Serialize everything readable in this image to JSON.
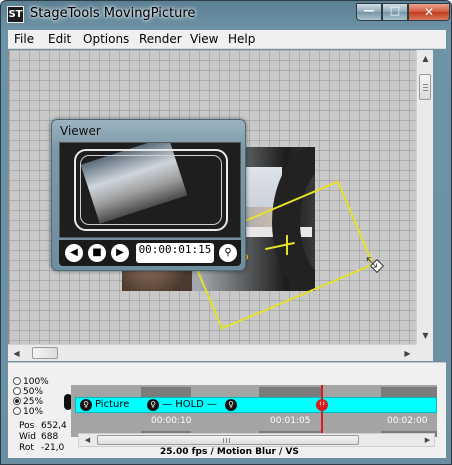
{
  "window": {
    "title": "StageTools MovingPicture",
    "app_icon": "ST",
    "controls": {
      "minimize": "—",
      "maximize": "□",
      "close": "✕"
    }
  },
  "menu": [
    "File",
    "Edit",
    "Options",
    "Render",
    "View",
    "Help"
  ],
  "viewer": {
    "title": "Viewer",
    "timecode": "00:00:01:15",
    "buttons": {
      "prev": "◀",
      "stop": "■",
      "next": "▶",
      "keyframe": "⚲"
    }
  },
  "zoom_options": [
    {
      "label": "100%",
      "selected": false
    },
    {
      "label": "50%",
      "selected": false
    },
    {
      "label": "25%",
      "selected": true
    },
    {
      "label": "10%",
      "selected": false
    }
  ],
  "info": {
    "pos_label": "Pos",
    "pos_value": "652,4",
    "wid_label": "Wid",
    "wid_value": "688",
    "rot_label": "Rot",
    "rot_value": "-21,0"
  },
  "timeline": {
    "track_name": "Picture",
    "hold_label": "HOLD",
    "ticks": [
      "00:00:10",
      "00:01:05",
      "00:02:00"
    ]
  },
  "status": "25.00 fps / Motion Blur / VS",
  "scroll_arrows": {
    "up": "▲",
    "down": "▼",
    "left": "◀",
    "right": "▶"
  },
  "colors": {
    "track": "#00ffff",
    "selection": "#e2e02a",
    "playhead": "#e01818"
  },
  "icons": [
    "app-icon",
    "minimize-icon",
    "maximize-icon",
    "close-icon",
    "prev-frame-icon",
    "stop-icon",
    "next-frame-icon",
    "keyframe-icon",
    "resize-cursor-icon"
  ]
}
